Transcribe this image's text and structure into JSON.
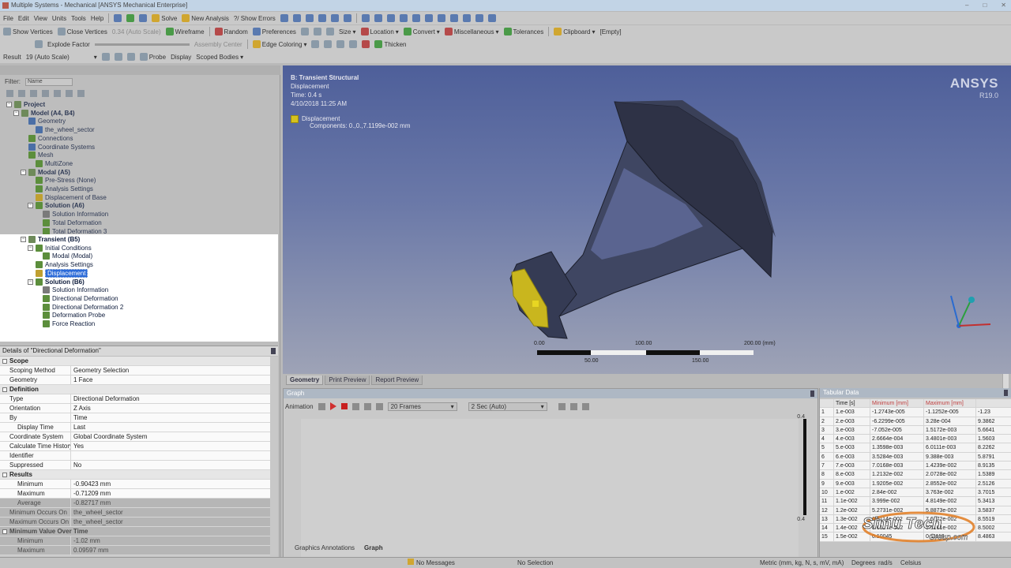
{
  "window": {
    "title": "Multiple Systems - Mechanical [ANSYS Mechanical Enterprise]"
  },
  "menubar": {
    "items": [
      "File",
      "Edit",
      "View",
      "Units",
      "Tools",
      "Help"
    ],
    "solve": "Solve",
    "new_analysis": "New Analysis",
    "show_errors": "?/ Show Errors"
  },
  "toolbar2": {
    "show_vertices": "Show Vertices",
    "close_vertices": "Close Vertices",
    "auto_scale": "0.34 (Auto Scale)",
    "wireframe": "Wireframe",
    "random": "Random",
    "preferences": "Preferences",
    "size": "Size",
    "location": "Location",
    "convert": "Convert",
    "miscellaneous": "Miscellaneous",
    "tolerances": "Tolerances",
    "clipboard": "Clipboard",
    "empty": "[Empty]"
  },
  "toolbar3": {
    "explode_factor": "Explode Factor",
    "assembly_center": "Assembly Center",
    "edge_coloring": "Edge Coloring",
    "thicken": "Thicken"
  },
  "toolbar4": {
    "result": "Result",
    "result_scale": "19 (Auto Scale)",
    "probe": "Probe",
    "display": "Display",
    "scoped_bodies": "Scoped Bodies"
  },
  "outline": {
    "filter_label": "Filter:",
    "filter_value": "Name",
    "tree_dim": [
      {
        "label": "Project",
        "indent": 0,
        "icon": "gear",
        "bold": true
      },
      {
        "label": "Model (A4, B4)",
        "indent": 1,
        "icon": "gear",
        "bold": true
      },
      {
        "label": "Geometry",
        "indent": 2,
        "icon": "blue",
        "bold": false
      },
      {
        "label": "the_wheel_sector",
        "indent": 3,
        "icon": "blue",
        "bold": false
      },
      {
        "label": "Connections",
        "indent": 2,
        "icon": "check",
        "bold": false
      },
      {
        "label": "Coordinate Systems",
        "indent": 2,
        "icon": "blue",
        "bold": false
      },
      {
        "label": "Mesh",
        "indent": 2,
        "icon": "check",
        "bold": false
      },
      {
        "label": "MultiZone",
        "indent": 3,
        "icon": "check",
        "bold": false
      },
      {
        "label": "Modal (A5)",
        "indent": 2,
        "icon": "gear",
        "bold": true
      },
      {
        "label": "Pre-Stress (None)",
        "indent": 3,
        "icon": "check",
        "bold": false
      },
      {
        "label": "Analysis Settings",
        "indent": 3,
        "icon": "check",
        "bold": false
      },
      {
        "label": "Displacement of Base",
        "indent": 3,
        "icon": "yellow",
        "bold": false
      },
      {
        "label": "Solution (A6)",
        "indent": 3,
        "icon": "check",
        "bold": true
      },
      {
        "label": "Solution Information",
        "indent": 4,
        "icon": "info",
        "bold": false
      },
      {
        "label": "Total Deformation",
        "indent": 4,
        "icon": "check",
        "bold": false
      },
      {
        "label": "Total Deformation 3",
        "indent": 4,
        "icon": "check",
        "bold": false
      }
    ],
    "tree_bright": [
      {
        "label": "Transient (B5)",
        "indent": 2,
        "icon": "gear",
        "bold": true,
        "selected": false
      },
      {
        "label": "Initial Conditions",
        "indent": 3,
        "icon": "check",
        "bold": false,
        "selected": false
      },
      {
        "label": "Modal (Modal)",
        "indent": 4,
        "icon": "check",
        "bold": false,
        "selected": false
      },
      {
        "label": "Analysis Settings",
        "indent": 3,
        "icon": "check",
        "bold": false,
        "selected": false
      },
      {
        "label": "Displacement",
        "indent": 3,
        "icon": "yellow",
        "bold": false,
        "selected": true
      },
      {
        "label": "Solution (B6)",
        "indent": 3,
        "icon": "check",
        "bold": true,
        "selected": false
      },
      {
        "label": "Solution Information",
        "indent": 4,
        "icon": "info",
        "bold": false,
        "selected": false
      },
      {
        "label": "Directional Deformation",
        "indent": 4,
        "icon": "check",
        "bold": false,
        "selected": false
      },
      {
        "label": "Directional Deformation 2",
        "indent": 4,
        "icon": "check",
        "bold": false,
        "selected": false
      },
      {
        "label": "Deformation Probe",
        "indent": 4,
        "icon": "check",
        "bold": false,
        "selected": false
      },
      {
        "label": "Force Reaction",
        "indent": 4,
        "icon": "check",
        "bold": false,
        "selected": false
      }
    ]
  },
  "details": {
    "title": "Details of \"Directional Deformation\"",
    "rows": [
      {
        "k": "Scope",
        "v": "",
        "type": "group"
      },
      {
        "k": "Scoping Method",
        "v": "Geometry Selection",
        "type": "row"
      },
      {
        "k": "Geometry",
        "v": "1 Face",
        "type": "row"
      },
      {
        "k": "Definition",
        "v": "",
        "type": "group"
      },
      {
        "k": "Type",
        "v": "Directional Deformation",
        "type": "row"
      },
      {
        "k": "Orientation",
        "v": "Z Axis",
        "type": "row"
      },
      {
        "k": "By",
        "v": "Time",
        "type": "row"
      },
      {
        "k": "Display Time",
        "v": "Last",
        "type": "sub"
      },
      {
        "k": "Coordinate System",
        "v": "Global Coordinate System",
        "type": "row"
      },
      {
        "k": "Calculate Time History",
        "v": "Yes",
        "type": "row"
      },
      {
        "k": "Identifier",
        "v": "",
        "type": "row"
      },
      {
        "k": "Suppressed",
        "v": "No",
        "type": "row"
      },
      {
        "k": "Results",
        "v": "",
        "type": "group"
      },
      {
        "k": "Minimum",
        "v": "-0.90423 mm",
        "type": "sub"
      },
      {
        "k": "Maximum",
        "v": "-0.71209 mm",
        "type": "sub"
      },
      {
        "k": "Average",
        "v": "-0.82717 mm",
        "type": "dimsub"
      },
      {
        "k": "Minimum Occurs On",
        "v": "the_wheel_sector",
        "type": "dim"
      },
      {
        "k": "Maximum Occurs On",
        "v": "the_wheel_sector",
        "type": "dim"
      },
      {
        "k": "Minimum Value Over Time",
        "v": "",
        "type": "dimgroup"
      },
      {
        "k": "Minimum",
        "v": "-1.02 mm",
        "type": "dimsub"
      },
      {
        "k": "Maximum",
        "v": "0.09597 mm",
        "type": "dimsub"
      }
    ]
  },
  "viewport": {
    "heading": "B: Transient Structural",
    "subtitle": "Displacement",
    "time": "Time: 0.4 s",
    "date": "4/10/2018 11:25 AM",
    "legend_label": "Displacement",
    "legend_components": "Components: 0.,0.,7.1199e-002 mm",
    "brand": "ANSYS",
    "version": "R19.0",
    "scale_top": [
      "0.00",
      "100.00",
      "200.00 (mm)"
    ],
    "scale_bottom": [
      "50.00",
      "150.00"
    ],
    "tabs": [
      "Geometry",
      "Print Preview",
      "Report Preview"
    ],
    "accent": "#d6c21d"
  },
  "graph": {
    "title": "Graph",
    "animation_label": "Animation",
    "frames": "20 Frames",
    "duration": "2 Sec (Auto)",
    "axis_top": "0.4",
    "axis_bottom": "0.4",
    "bottom_tabs": [
      "Graphics Annotations",
      "Graph"
    ]
  },
  "tabular": {
    "title": "Tabular Data",
    "headers": [
      "",
      "Time [s]",
      "Minimum [mm]",
      "Maximum [mm]",
      ""
    ],
    "rows": [
      [
        "1",
        "1.e-003",
        "-1.2743e-005",
        "-1.1252e-005",
        "-1.23"
      ],
      [
        "2",
        "2.e-003",
        "-6.2299e-005",
        "3.28e-004",
        "9.3862"
      ],
      [
        "3",
        "3.e-003",
        "-7.052e-005",
        "1.5172e-003",
        "5.6641"
      ],
      [
        "4",
        "4.e-003",
        "2.6664e-004",
        "3.4801e-003",
        "1.5603"
      ],
      [
        "5",
        "5.e-003",
        "1.3598e-003",
        "6.0111e-003",
        "8.2262"
      ],
      [
        "6",
        "6.e-003",
        "3.5284e-003",
        "9.388e-003",
        "5.8791"
      ],
      [
        "7",
        "7.e-003",
        "7.0168e-003",
        "1.4239e-002",
        "8.9135"
      ],
      [
        "8",
        "8.e-003",
        "1.2132e-002",
        "2.0728e-002",
        "1.5389"
      ],
      [
        "9",
        "9.e-003",
        "1.9205e-002",
        "2.8552e-002",
        "2.5126"
      ],
      [
        "10",
        "1.e-002",
        "2.84e-002",
        "3.763e-002",
        "3.7015"
      ],
      [
        "11",
        "1.1e-002",
        "3.999e-002",
        "4.8149e-002",
        "5.3413"
      ],
      [
        "12",
        "1.2e-002",
        "5.2731e-002",
        "5.8873e-002",
        "3.5837"
      ],
      [
        "13",
        "1.3e-002",
        "6.9114e-002",
        "7.6172e-002",
        "8.5519"
      ],
      [
        "14",
        "1.4e-002",
        "8.6127e-002",
        "9.5161e-002",
        "8.5002"
      ],
      [
        "15",
        "1.5e-002",
        "0.10045",
        "0.11119",
        "8.4863"
      ]
    ]
  },
  "status": {
    "messages": "No Messages",
    "selection": "No Selection",
    "units": "Metric (mm, kg, N, s, mV, mA)",
    "degrees": "Degrees",
    "rads": "rad/s",
    "celsius": "Celsius"
  },
  "watermark": {
    "main": "Simu Tech",
    "sub": "Group.com"
  }
}
